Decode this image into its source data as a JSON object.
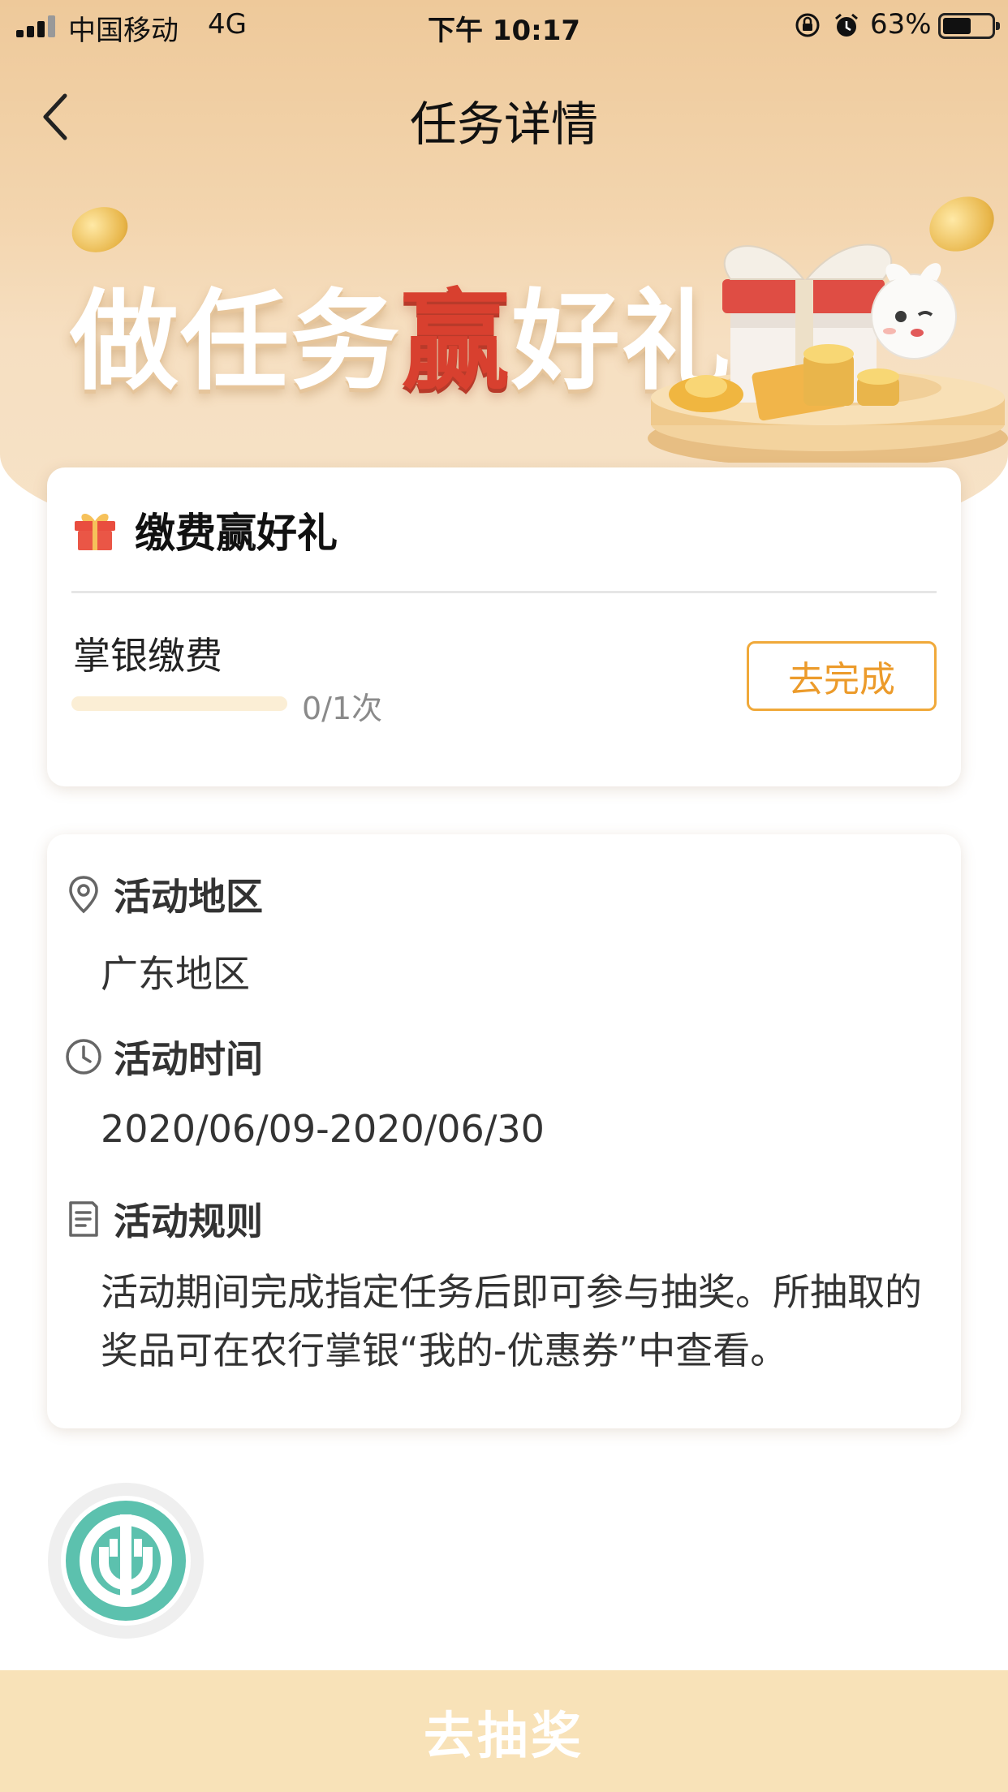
{
  "status_bar": {
    "carrier": "中国移动",
    "network": "4G",
    "time": "下午 10:17",
    "battery_percent": "63%",
    "battery_level": 0.63
  },
  "nav": {
    "title": "任务详情",
    "back_icon": "chevron-left-icon"
  },
  "banner": {
    "title_part1": "做任务",
    "title_highlight": "赢",
    "title_part2": "好礼",
    "accent_color": "#d8402f"
  },
  "task_card": {
    "title": "缴费赢好礼",
    "icon": "gift-icon",
    "task_name": "掌银缴费",
    "progress_text": "0/1次",
    "progress": 0,
    "action_label": "去完成",
    "accent_color": "#f0a93a"
  },
  "info_card": {
    "region": {
      "icon": "location-pin-icon",
      "label": "活动地区",
      "value": "广东地区"
    },
    "time": {
      "icon": "clock-icon",
      "label": "活动时间",
      "value": "2020/06/09-2020/06/30"
    },
    "rules": {
      "icon": "document-icon",
      "label": "活动规则",
      "value": "活动期间完成指定任务后即可参与抽奖。所抽取的奖品可在农行掌银“我的-优惠券”中查看。"
    }
  },
  "bank_logo": {
    "icon": "agricultural-bank-logo-icon",
    "color": "#5cc1ae"
  },
  "footer": {
    "draw_label": "去抽奖",
    "background": "#f8e2b8"
  }
}
